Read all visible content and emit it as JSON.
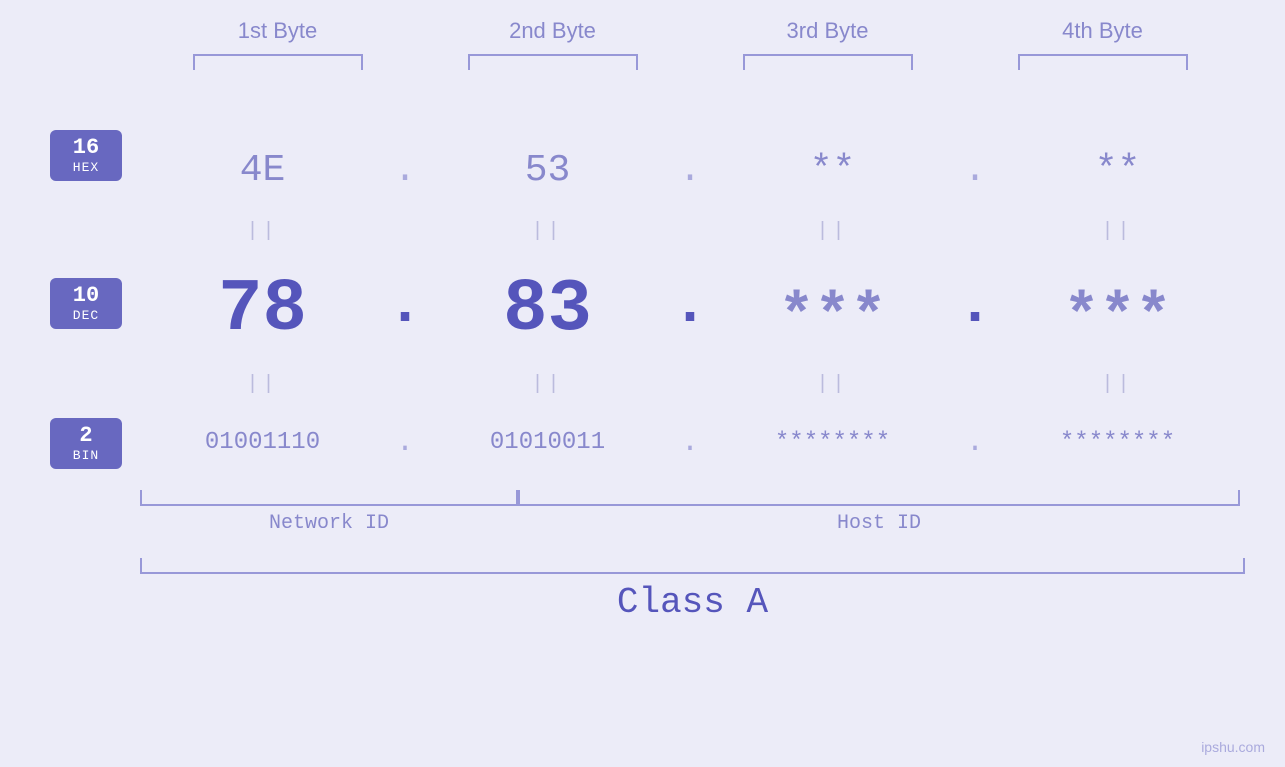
{
  "page": {
    "background": "#ececf8",
    "watermark": "ipshu.com"
  },
  "byte_headers": {
    "b1": "1st Byte",
    "b2": "2nd Byte",
    "b3": "3rd Byte",
    "b4": "4th Byte"
  },
  "badges": {
    "hex": {
      "number": "16",
      "label": "HEX"
    },
    "dec": {
      "number": "10",
      "label": "DEC"
    },
    "bin": {
      "number": "2",
      "label": "BIN"
    }
  },
  "hex_values": {
    "b1": "4E",
    "b2": "53",
    "b3": "**",
    "b4": "**"
  },
  "dec_values": {
    "b1": "78",
    "b2": "83",
    "b3": "***",
    "b4": "***"
  },
  "bin_values": {
    "b1": "01001110",
    "b2": "01010011",
    "b3": "********",
    "b4": "********"
  },
  "labels": {
    "network_id": "Network ID",
    "host_id": "Host ID",
    "class": "Class A"
  },
  "equals_sign": "||",
  "dot": "."
}
